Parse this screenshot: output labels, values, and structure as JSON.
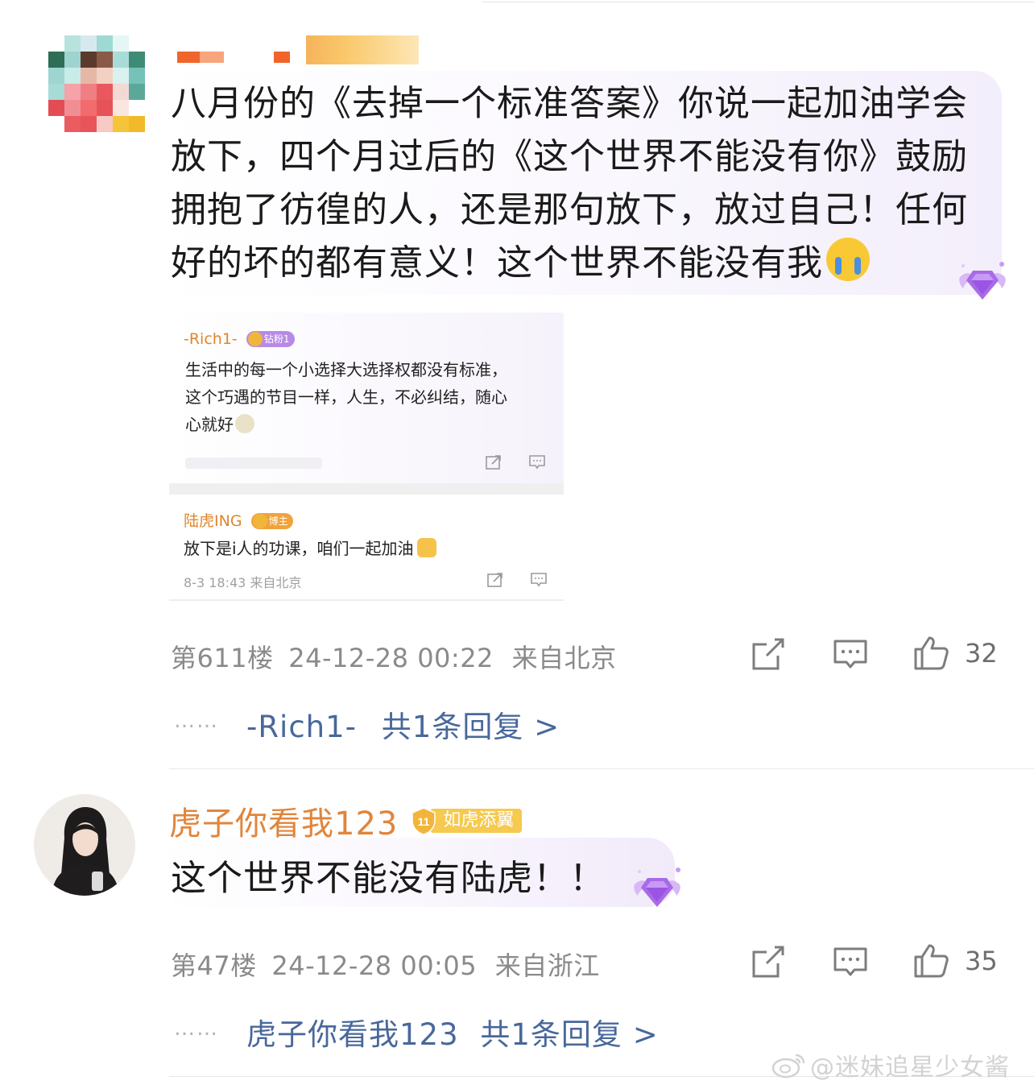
{
  "comments": [
    {
      "text": "八月份的《去掉一个标准答案》你说一起加油学会放下，四个月过后的《这个世界不能没有你》鼓励拥抱了彷徨的人，还是那句放下，放过自己！任何好的坏的都有意义！这个世界不能没有我",
      "emoji_icon": "loudly-crying-face-icon",
      "floor": "第611楼",
      "time": "24-12-28 00:22",
      "location": "来自北京",
      "likes": "32",
      "reply_user": "-Rich1-",
      "reply_count": "共1条回复 >",
      "reply_dots": "……",
      "embedded_screenshot": {
        "first": {
          "user": "-Rich1-",
          "badge": "钻粉1",
          "text_lines": [
            "生活中的每一个小选择大选择权都没有标准，",
            "这个巧遇的节目一样，人生，不必纠结，随心",
            "心就好"
          ]
        },
        "second": {
          "user": "陆虎ING",
          "badge": "博主",
          "text": "放下是i人的功课，咱们一起加油",
          "meta": "8-3 18:43  来自北京"
        }
      }
    },
    {
      "user": "虎子你看我123",
      "level": "11",
      "badge": "如虎添翼",
      "text": "这个世界不能没有陆虎！！",
      "floor": "第47楼",
      "time": "24-12-28 00:05",
      "location": "来自浙江",
      "likes": "35",
      "reply_user": "虎子你看我123",
      "reply_count": "共1条回复 >",
      "reply_dots": "……"
    }
  ],
  "watermark": "@迷妹追星少女酱",
  "colors": {
    "username": "#e1853b",
    "reply_link": "#48689b",
    "meta_gray": "#8a8a8a",
    "gem_purple": "#a86be8"
  }
}
